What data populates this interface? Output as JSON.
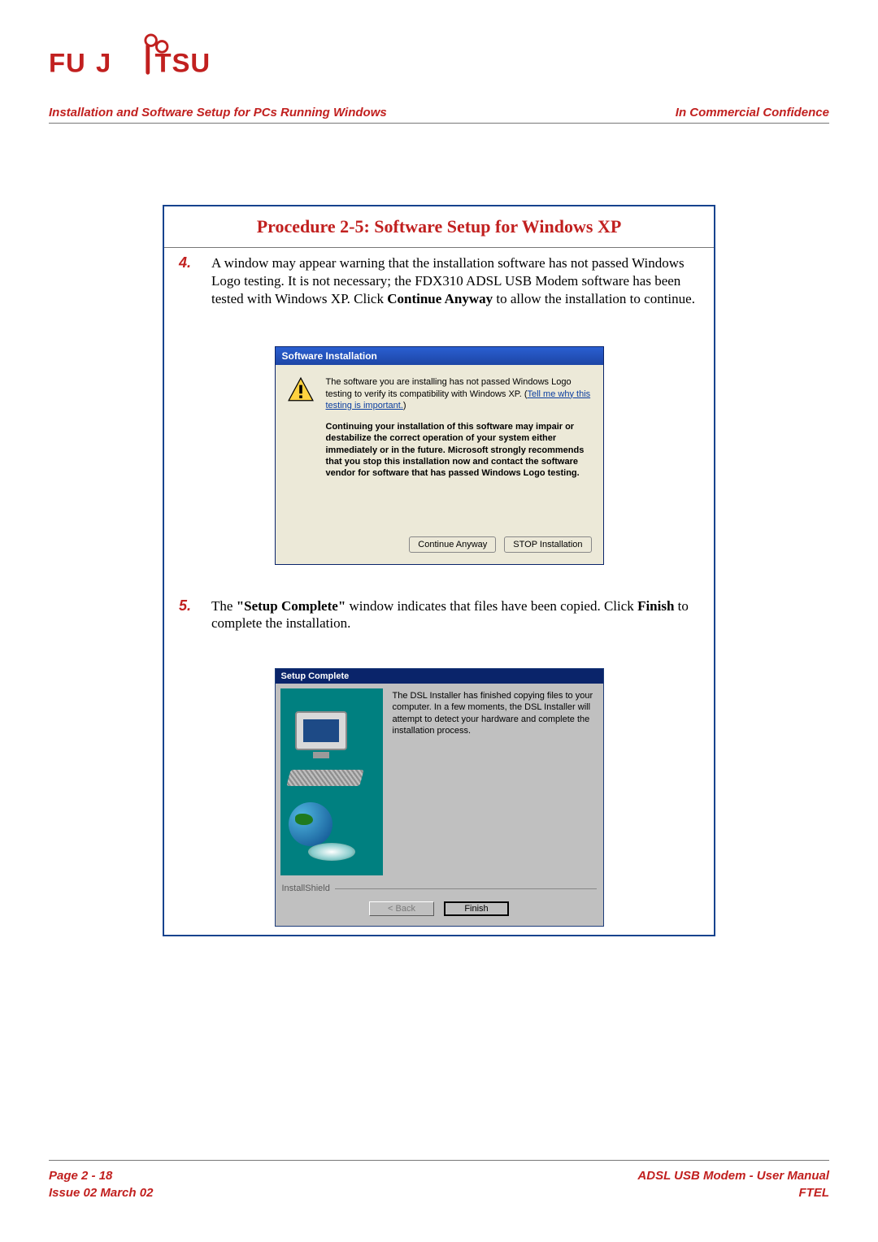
{
  "brand": "FUJITSU",
  "header": {
    "left": "Installation and Software Setup for PCs Running Windows",
    "right": "In Commercial Confidence"
  },
  "procedure": {
    "title": "Procedure 2-5: Software Setup for Windows XP",
    "step4": {
      "num": "4.",
      "text_before_bold": "A window may appear warning that the installation software has not passed Windows Logo testing. It is not necessary; the FDX310 ADSL USB Modem software has been tested with Windows XP. Click ",
      "bold": "Continue Anyway",
      "text_after_bold": " to allow the installation to continue."
    },
    "step5": {
      "num": "5.",
      "t1": "The ",
      "b1": "\"Setup Complete\"",
      "t2": " window indicates that files have been copied. Click ",
      "b2": "Finish",
      "t3": " to complete the installation."
    }
  },
  "xp_dialog": {
    "title": "Software Installation",
    "msg1": "The software you are installing has not passed Windows Logo testing to verify its compatibility with Windows XP. (",
    "link": "Tell me why this testing is important.",
    "msg1_close": ")",
    "bold": "Continuing your installation of this software may impair or destabilize the correct operation of your system either immediately or in the future. Microsoft strongly recommends that you stop this installation now and contact the software vendor for software that has passed Windows Logo testing.",
    "btn_continue": "Continue Anyway",
    "btn_stop": "STOP Installation"
  },
  "ish_dialog": {
    "title": "Setup Complete",
    "msg": "The DSL Installer has finished copying files to your computer.  In a few moments, the DSL Installer will attempt to detect your hardware and complete the installation process.",
    "brand": "InstallShield",
    "btn_back": "< Back",
    "btn_finish": "Finish"
  },
  "footer": {
    "page": "Page 2 - 18",
    "issue": "Issue 02 March 02",
    "product": "ADSL USB Modem - User Manual",
    "company": "FTEL"
  }
}
